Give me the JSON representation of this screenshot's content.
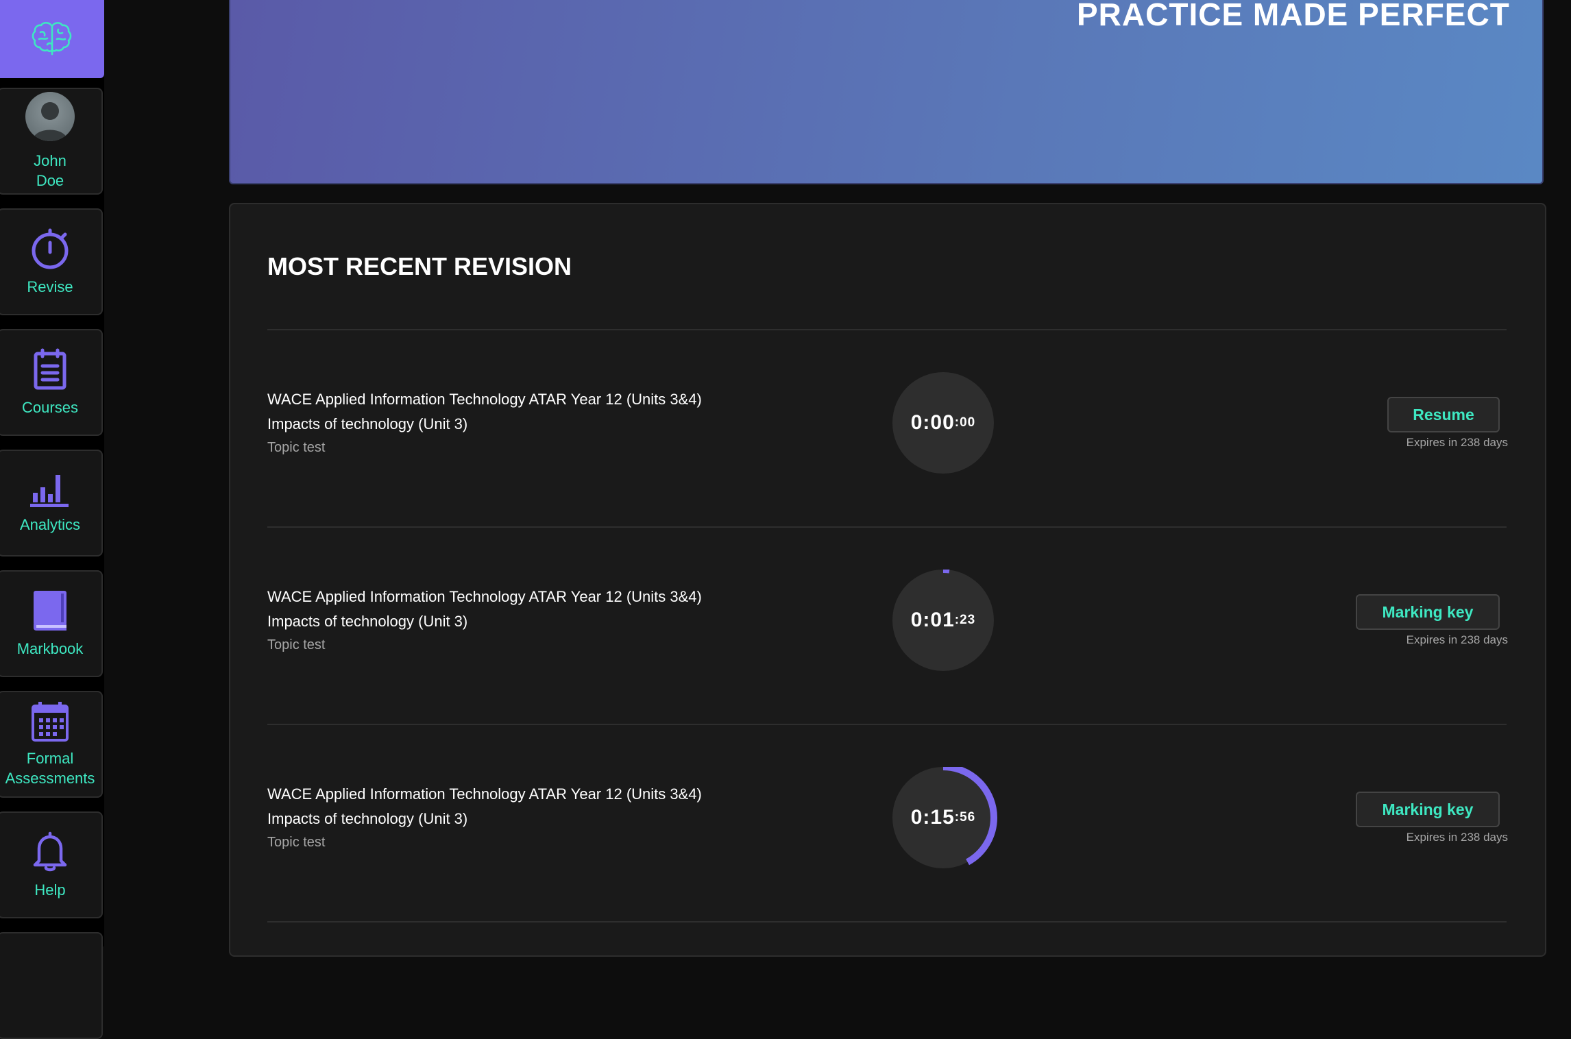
{
  "banner": {
    "title": "PRACTICE MADE PERFECT"
  },
  "sidebar": {
    "logo_icon": "brain-icon",
    "user": {
      "first": "John",
      "last": "Doe"
    },
    "items": [
      {
        "label": "Revise",
        "icon": "stopwatch-icon"
      },
      {
        "label": "Courses",
        "icon": "clipboard-icon"
      },
      {
        "label": "Analytics",
        "icon": "bar-chart-icon"
      },
      {
        "label": "Markbook",
        "icon": "book-icon"
      },
      {
        "label_line1": "Formal",
        "label_line2": "Assessments",
        "icon": "calendar-icon"
      },
      {
        "label": "Help",
        "icon": "bell-icon"
      }
    ]
  },
  "colors": {
    "accent": "#7b68ee",
    "teal": "#3ee8c2"
  },
  "recent": {
    "title": "MOST RECENT REVISION",
    "rows": [
      {
        "course": "WACE Applied Information Technology ATAR Year 12 (Units 3&4)",
        "topic": "Impacts of technology (Unit 3)",
        "type": "Topic test",
        "timer_main": "0:00",
        "timer_sec": ":00",
        "progress": 0,
        "button": "Resume",
        "expires": "Expires in 238 days"
      },
      {
        "course": "WACE Applied Information Technology ATAR Year 12 (Units 3&4)",
        "topic": "Impacts of technology (Unit 3)",
        "type": "Topic test",
        "timer_main": "0:01",
        "timer_sec": ":23",
        "progress": 0.02,
        "button": "Marking key",
        "expires": "Expires in 238 days"
      },
      {
        "course": "WACE Applied Information Technology ATAR Year 12 (Units 3&4)",
        "topic": "Impacts of technology (Unit 3)",
        "type": "Topic test",
        "timer_main": "0:15",
        "timer_sec": ":56",
        "progress": 0.42,
        "button": "Marking key",
        "expires": "Expires in 238 days"
      }
    ]
  }
}
